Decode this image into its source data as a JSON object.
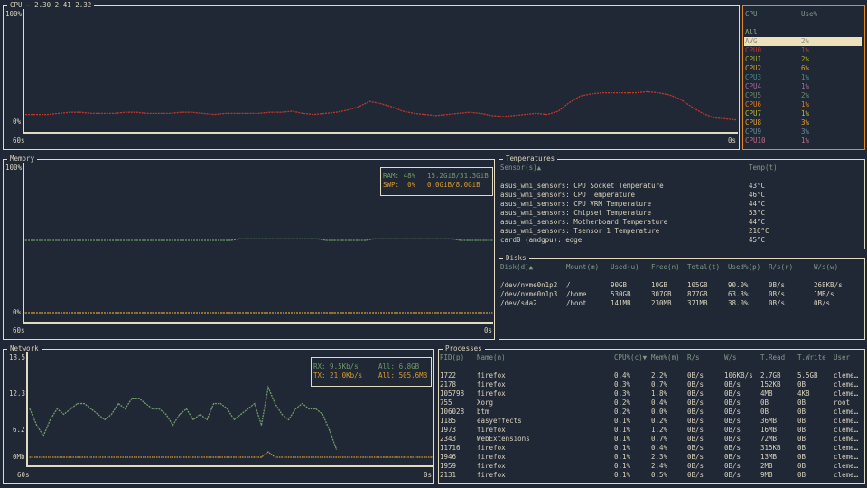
{
  "colors": {
    "border": "#e2dbbf",
    "bg": "#212835",
    "header": "#7e9a8a",
    "cpu_line": "#c0392b",
    "rx": "#6e9a6a",
    "tx": "#d89a2a",
    "ram": "#6e9a6a",
    "swap": "#d89a2a",
    "cpu_panel_border": "#e08a2a"
  },
  "cpu": {
    "title": "CPU – 2.30 2.41 2.32",
    "y_top": "100%",
    "y_bottom": "0%",
    "x_left": "60s",
    "x_right": "0s",
    "list_header": {
      "cpu": "CPU",
      "use": "Use%"
    },
    "all_label": "All",
    "rows": [
      {
        "name": "AVG",
        "use": "2%",
        "color": "#8a8a7a",
        "selected": true
      },
      {
        "name": "CPU0",
        "use": "1%",
        "color": "#c0392b"
      },
      {
        "name": "CPU1",
        "use": "2%",
        "color": "#a8a832"
      },
      {
        "name": "CPU2",
        "use": "6%",
        "color": "#d8a030"
      },
      {
        "name": "CPU3",
        "use": "1%",
        "color": "#4a8a8a"
      },
      {
        "name": "CPU4",
        "use": "1%",
        "color": "#a06a9a"
      },
      {
        "name": "CPU5",
        "use": "2%",
        "color": "#6a8a6a"
      },
      {
        "name": "CPU6",
        "use": "1%",
        "color": "#e07a20"
      },
      {
        "name": "CPU7",
        "use": "1%",
        "color": "#b8b830"
      },
      {
        "name": "CPU8",
        "use": "3%",
        "color": "#e0a030"
      },
      {
        "name": "CPU9",
        "use": "3%",
        "color": "#6a8a9a"
      },
      {
        "name": "CPU10",
        "use": "1%",
        "color": "#c06a8a"
      }
    ]
  },
  "memory": {
    "title": "Memory",
    "y_top": "100%",
    "y_bottom": "0%",
    "x_left": "60s",
    "x_right": "0s",
    "ram_label": "RAM: 48%",
    "ram_value": "15.2GiB/31.3GiB",
    "swap_label": "SWP:  0%",
    "swap_value": "0.0GiB/8.0GiB"
  },
  "temperatures": {
    "title": "Temperatures",
    "headers": [
      "Sensor(s)▲",
      "Temp(t)"
    ],
    "rows": [
      [
        "asus_wmi_sensors: CPU Socket Temperature",
        "43°C"
      ],
      [
        "asus_wmi_sensors: CPU Temperature",
        "46°C"
      ],
      [
        "asus_wmi_sensors: CPU VRM Temperature",
        "44°C"
      ],
      [
        "asus_wmi_sensors: Chipset Temperature",
        "53°C"
      ],
      [
        "asus_wmi_sensors: Motherboard Temperature",
        "44°C"
      ],
      [
        "asus_wmi_sensors: Tsensor 1 Temperature",
        "216°C"
      ],
      [
        "card0 (amdgpu): edge",
        "45°C"
      ]
    ]
  },
  "disks": {
    "title": "Disks",
    "headers": [
      "Disk(d)▲",
      "Mount(m)",
      "Used(u)",
      "Free(n)",
      "Total(t)",
      "Used%(p)",
      "R/s(r)",
      "W/s(w)"
    ],
    "rows": [
      [
        "/dev/nvme0n1p2",
        "/",
        "90GB",
        "10GB",
        "105GB",
        "90.0%",
        "0B/s",
        "268KB/s"
      ],
      [
        "/dev/nvme0n1p3",
        "/home",
        "530GB",
        "307GB",
        "877GB",
        "63.3%",
        "0B/s",
        "1MB/s"
      ],
      [
        "/dev/sda2",
        "/boot",
        "141MB",
        "230MB",
        "371MB",
        "38.0%",
        "0B/s",
        "0B/s"
      ]
    ]
  },
  "network": {
    "title": "Network",
    "y_ticks": [
      "18.5",
      "12.3",
      "6.2",
      "0Mb"
    ],
    "x_left": "60s",
    "x_right": "0s",
    "rx_label": "RX: 9.5Kb/s",
    "rx_all": "All: 6.8GB",
    "tx_label": "TX: 21.0Kb/s",
    "tx_all": "All: 505.6MB"
  },
  "processes": {
    "title": "Processes",
    "headers": [
      "PID(p)",
      "Name(n)",
      "CPU%(c)▼",
      "Mem%(m)",
      "R/s",
      "W/s",
      "T.Read",
      "T.Write",
      "User"
    ],
    "rows": [
      [
        "1722",
        "firefox",
        "0.4%",
        "2.2%",
        "0B/s",
        "106KB/s",
        "2.7GB",
        "5.5GB",
        "cleme…"
      ],
      [
        "2178",
        "firefox",
        "0.3%",
        "0.7%",
        "0B/s",
        "0B/s",
        "152KB",
        "0B",
        "cleme…"
      ],
      [
        "105798",
        "firefox",
        "0.3%",
        "1.8%",
        "0B/s",
        "0B/s",
        "4MB",
        "4KB",
        "cleme…"
      ],
      [
        "755",
        "Xorg",
        "0.2%",
        "0.4%",
        "0B/s",
        "0B/s",
        "0B",
        "0B",
        "root"
      ],
      [
        "106028",
        "btm",
        "0.2%",
        "0.0%",
        "0B/s",
        "0B/s",
        "0B",
        "0B",
        "cleme…"
      ],
      [
        "1185",
        "easyeffects",
        "0.1%",
        "0.2%",
        "0B/s",
        "0B/s",
        "36MB",
        "0B",
        "cleme…"
      ],
      [
        "1973",
        "firefox",
        "0.1%",
        "1.2%",
        "0B/s",
        "0B/s",
        "16MB",
        "0B",
        "cleme…"
      ],
      [
        "2343",
        "WebExtensions",
        "0.1%",
        "0.7%",
        "0B/s",
        "0B/s",
        "72MB",
        "0B",
        "cleme…"
      ],
      [
        "11716",
        "firefox",
        "0.1%",
        "0.4%",
        "0B/s",
        "0B/s",
        "315KB",
        "0B",
        "cleme…"
      ],
      [
        "1946",
        "firefox",
        "0.1%",
        "2.3%",
        "0B/s",
        "0B/s",
        "13MB",
        "0B",
        "cleme…"
      ],
      [
        "1959",
        "firefox",
        "0.1%",
        "2.4%",
        "0B/s",
        "0B/s",
        "2MB",
        "0B",
        "cleme…"
      ],
      [
        "2131",
        "firefox",
        "0.1%",
        "0.5%",
        "0B/s",
        "0B/s",
        "9MB",
        "0B",
        "cleme…"
      ]
    ]
  },
  "chart_data": [
    {
      "type": "line",
      "name": "cpu",
      "ylim": [
        0,
        100
      ],
      "xlim": [
        60,
        0
      ],
      "values": [
        7,
        7,
        7,
        8,
        9,
        9,
        8,
        8,
        8,
        9,
        9,
        8,
        8,
        8,
        9,
        9,
        8,
        7,
        8,
        8,
        8,
        8,
        9,
        9,
        10,
        8,
        7,
        8,
        9,
        11,
        14,
        19,
        17,
        14,
        10,
        8,
        7,
        6,
        7,
        8,
        9,
        8,
        6,
        5,
        6,
        7,
        8,
        7,
        10,
        18,
        24,
        26,
        27,
        27,
        27,
        27,
        28,
        27,
        25,
        21,
        14,
        8,
        4,
        3,
        2
      ]
    },
    {
      "type": "line",
      "name": "memory",
      "ylim": [
        0,
        100
      ],
      "xlim": [
        60,
        0
      ],
      "ram": [
        50,
        50,
        50,
        50,
        50,
        50,
        50,
        50,
        50,
        50,
        50,
        50,
        50,
        50,
        50,
        50,
        50,
        50,
        50,
        50,
        50,
        50,
        50,
        50,
        50,
        50,
        50,
        51,
        51,
        51,
        51,
        51,
        51,
        51,
        51,
        51,
        51,
        51,
        50,
        50,
        50,
        50,
        50,
        50,
        51,
        51,
        51,
        51,
        51,
        51,
        51,
        51,
        51,
        51,
        51,
        50,
        50,
        50,
        50,
        50
      ],
      "swap": [
        0,
        0,
        0,
        0,
        0,
        0,
        0,
        0,
        0,
        0,
        0,
        0,
        0,
        0,
        0,
        0,
        0,
        0,
        0,
        0,
        0,
        0,
        0,
        0,
        0,
        0,
        0,
        0,
        0,
        0,
        0,
        0,
        0,
        0,
        0,
        0,
        0,
        0,
        0,
        0,
        0,
        0,
        0,
        0,
        0,
        0,
        0,
        0,
        0,
        0,
        0,
        0,
        0,
        0,
        0,
        0,
        0,
        0,
        0,
        0
      ]
    },
    {
      "type": "line",
      "name": "network",
      "ylim": [
        0,
        18.5
      ],
      "xlim": [
        60,
        0
      ],
      "rx": [
        9,
        6,
        4,
        7,
        9,
        8,
        9,
        10,
        10,
        9,
        8,
        7,
        8,
        10,
        9,
        11,
        11,
        10,
        9,
        9,
        8,
        6,
        8,
        9,
        7,
        8,
        7,
        10,
        10,
        9,
        7,
        8,
        9,
        10,
        6,
        13,
        10,
        8,
        7,
        9,
        10,
        9,
        9,
        8,
        5,
        1.5
      ],
      "tx": [
        0,
        0,
        0,
        0,
        0,
        0,
        0,
        0,
        0,
        0,
        0,
        0,
        0,
        0,
        0,
        0,
        0,
        0,
        0,
        0,
        0,
        0,
        0,
        0,
        0,
        0,
        0,
        0,
        0,
        0,
        0,
        0,
        0,
        0,
        0,
        1,
        0,
        0,
        0,
        0,
        0,
        0,
        0,
        0,
        0,
        0,
        0,
        0,
        0,
        0,
        0,
        0,
        0,
        0,
        0,
        0,
        0,
        0,
        0,
        0
      ]
    }
  ]
}
